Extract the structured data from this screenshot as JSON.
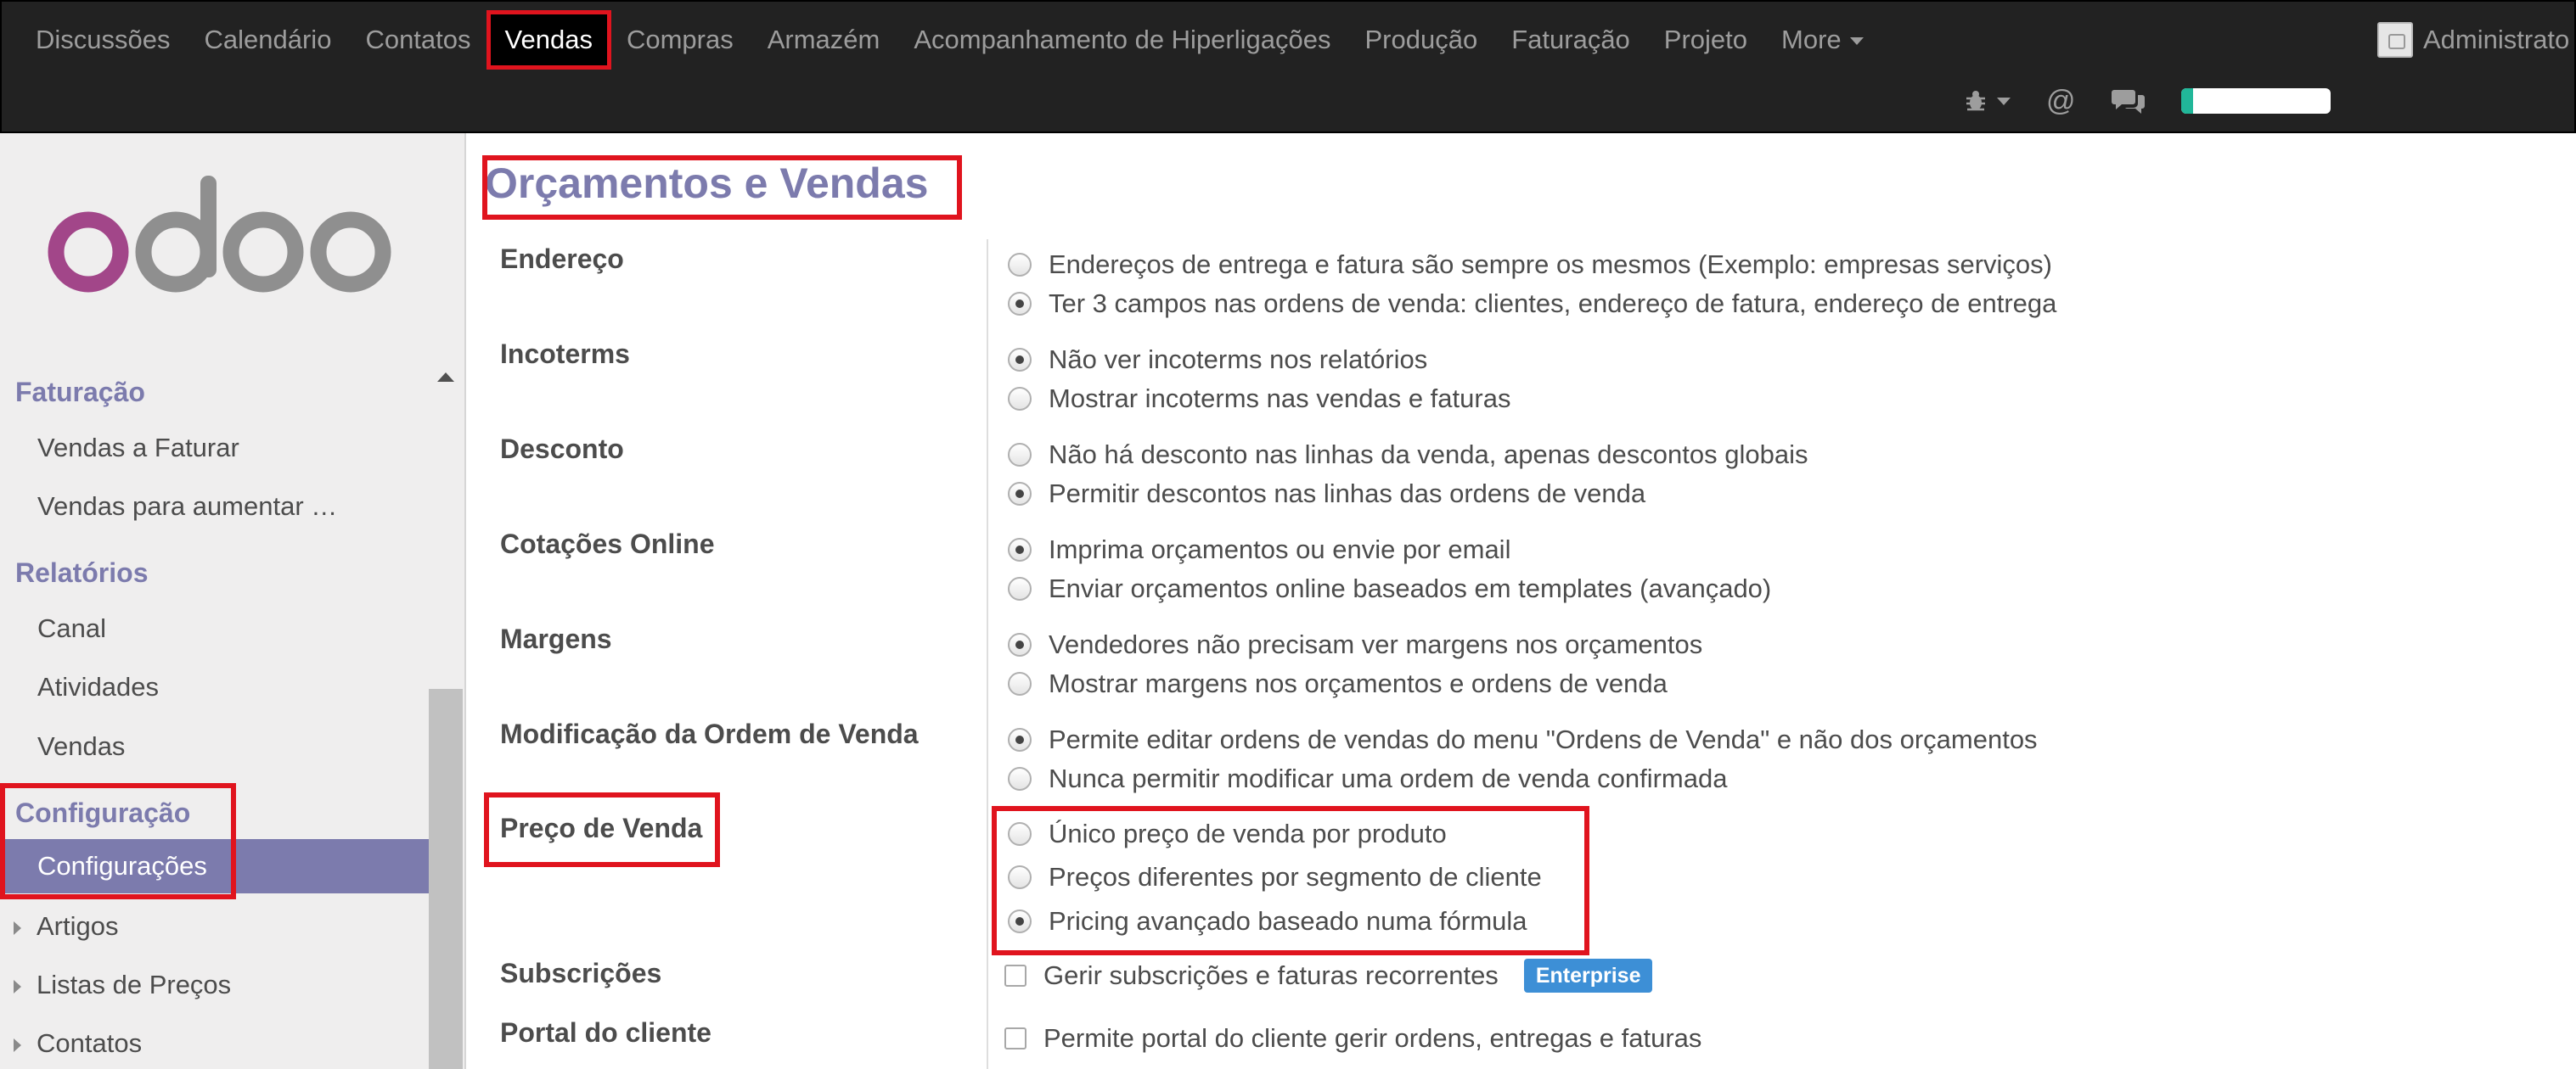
{
  "topnav": {
    "items": [
      {
        "label": "Discussões"
      },
      {
        "label": "Calendário"
      },
      {
        "label": "Contatos"
      },
      {
        "label": "Vendas",
        "active": true
      },
      {
        "label": "Compras"
      },
      {
        "label": "Armazém"
      },
      {
        "label": "Acompanhamento de Hiperligações"
      },
      {
        "label": "Produção"
      },
      {
        "label": "Faturação"
      },
      {
        "label": "Projeto"
      }
    ],
    "more_label": "More",
    "user_name": "Administrato",
    "systray": {
      "icons": [
        "bug-icon",
        "at-icon",
        "chat-icon"
      ],
      "progress_percent": 8
    }
  },
  "sidebar": {
    "logo": "odoo",
    "sections": [
      {
        "title": "Faturação",
        "items": [
          "Vendas a Faturar",
          "Vendas para aumentar …"
        ]
      },
      {
        "title": "Relatórios",
        "items": [
          "Canal",
          "Atividades",
          "Vendas"
        ]
      },
      {
        "title": "Configuração",
        "items": [
          "Configurações"
        ],
        "selected": "Configurações"
      }
    ],
    "folders": [
      "Artigos",
      "Listas de Preços",
      "Contatos"
    ]
  },
  "main": {
    "title": "Orçamentos e Vendas",
    "settings": [
      {
        "label": "Endereço",
        "options": [
          {
            "text": "Endereços de entrega e fatura são sempre os mesmos (Exemplo: empresas serviços)",
            "checked": false
          },
          {
            "text": "Ter 3 campos nas ordens de venda: clientes, endereço de fatura, endereço de entrega",
            "checked": true
          }
        ]
      },
      {
        "label": "Incoterms",
        "options": [
          {
            "text": "Não ver incoterms nos relatórios",
            "checked": true
          },
          {
            "text": "Mostrar incoterms nas vendas e faturas",
            "checked": false
          }
        ]
      },
      {
        "label": "Desconto",
        "options": [
          {
            "text": "Não há desconto nas linhas da venda, apenas descontos globais",
            "checked": false
          },
          {
            "text": "Permitir descontos nas linhas das ordens de venda",
            "checked": true
          }
        ]
      },
      {
        "label": "Cotações Online",
        "options": [
          {
            "text": "Imprima orçamentos ou envie por email",
            "checked": true
          },
          {
            "text": "Enviar orçamentos online baseados em templates (avançado)",
            "checked": false
          }
        ]
      },
      {
        "label": "Margens",
        "options": [
          {
            "text": "Vendedores não precisam ver margens nos orçamentos",
            "checked": true
          },
          {
            "text": "Mostrar margens nos orçamentos e ordens de venda",
            "checked": false
          }
        ]
      },
      {
        "label": "Modificação da Ordem de Venda",
        "options": [
          {
            "text": "Permite editar ordens de vendas do menu \"Ordens de Venda\" e não dos orçamentos",
            "checked": true
          },
          {
            "text": "Nunca permitir modificar uma ordem de venda confirmada",
            "checked": false
          }
        ]
      },
      {
        "label": "Preço de Venda",
        "options": [
          {
            "text": "Único preço de venda por produto",
            "checked": false
          },
          {
            "text": "Preços diferentes por segmento de cliente",
            "checked": false
          },
          {
            "text": "Pricing avançado baseado numa fórmula",
            "checked": true
          }
        ]
      },
      {
        "label": "Subscrições",
        "checkbox": {
          "text": "Gerir subscrições e faturas recorrentes",
          "checked": false,
          "badge": "Enterprise"
        }
      },
      {
        "label": "Portal do cliente",
        "checkbox": {
          "text": "Permite portal do cliente gerir ordens, entregas e faturas",
          "checked": false
        }
      }
    ]
  },
  "colors": {
    "accent": "#7c7bad",
    "topbar": "#222222",
    "highlight": "#e0141e",
    "badge": "#3d8fd6",
    "progress": "#21b799"
  }
}
